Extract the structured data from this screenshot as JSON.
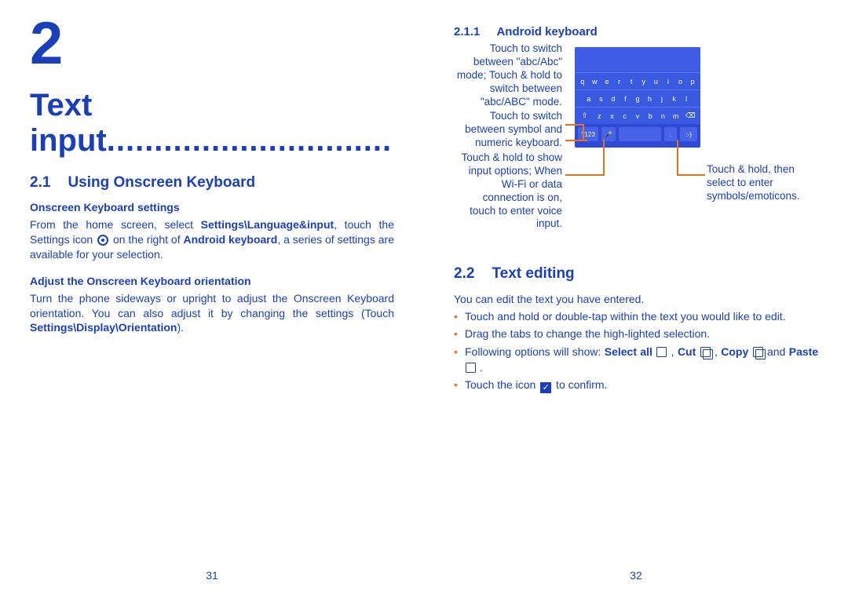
{
  "leftPage": {
    "chapterNum": "2",
    "chapterTitle": "Text input",
    "dots": "..............................",
    "sec1Num": "2.1",
    "sec1Title": "Using Onscreen Keyboard",
    "sub1": "Onscreen Keyboard settings",
    "para1a": "From the home screen, select ",
    "para1b": "Settings\\Language&input",
    "para1c": ", touch the Settings icon ",
    "para1d": " on the right of ",
    "para1e": "Android keyboard",
    "para1f": ", a series of settings are available for your selection.",
    "sub2": "Adjust the Onscreen Keyboard orientation",
    "para2a": "Turn the phone sideways or upright to adjust the Onscreen Keyboard orientation. You can also adjust it by changing the settings (Touch ",
    "para2b": "Settings\\Display\\Orientation",
    "para2c": ").",
    "pageNum": "31"
  },
  "rightPage": {
    "subNum": "2.1.1",
    "subTitle": "Android keyboard",
    "calloutL1": "Touch to switch between \"abc/Abc\" mode; Touch & hold to switch between \"abc/ABC\" mode.",
    "calloutL2": "Touch to switch between symbol and numeric keyboard.",
    "calloutL3": "Touch & hold to show input options; When Wi-Fi or data connection is on, touch to enter voice input.",
    "calloutR1": "Touch & hold, then select to enter symbols/emoticons.",
    "kbRow1": [
      "q",
      "w",
      "e",
      "r",
      "t",
      "y",
      "u",
      "i",
      "o",
      "p"
    ],
    "kbRow2": [
      "a",
      "s",
      "d",
      "f",
      "g",
      "h",
      "j",
      "k",
      "l"
    ],
    "kbRow3": [
      "z",
      "x",
      "c",
      "v",
      "b",
      "n",
      "m"
    ],
    "kbShift": "⇧",
    "kbDel": "⌫",
    "kbSym": "?123",
    "kbMic": "🎤",
    "kbSpace": "",
    "kbPeriod": ".",
    "kbSmile": ":-)",
    "sec2Num": "2.2",
    "sec2Title": "Text editing",
    "intro": "You can edit the text you have entered.",
    "b1": "Touch and hold or double-tap within the text you would like to edit.",
    "b2": "Drag the tabs to change the high-lighted selection.",
    "b3a": "Following options will show: ",
    "b3SelectAll": "Select all",
    "b3Cut": "Cut",
    "b3Copy": "Copy",
    "b3and": " and ",
    "b3Paste": "Paste",
    "b4a": "Touch the icon ",
    "b4b": " to confirm.",
    "pageNum": "32"
  }
}
